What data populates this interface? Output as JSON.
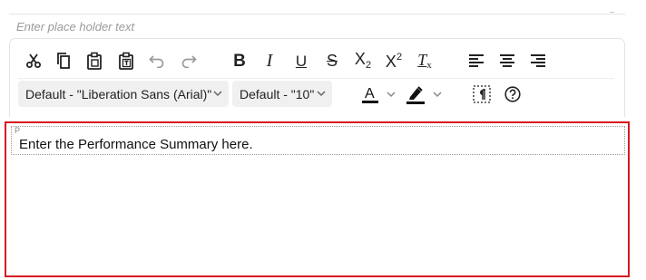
{
  "placeholder": "Enter place holder text",
  "toolbar": {
    "row1": [
      {
        "name": "cut-button",
        "icon": "scissors-icon"
      },
      {
        "name": "copy-button",
        "icon": "copy-icon"
      },
      {
        "name": "paste-button",
        "icon": "clipboard-icon"
      },
      {
        "name": "paste-text-button",
        "icon": "clipboard-text-icon"
      },
      {
        "name": "undo-button",
        "icon": "undo-icon",
        "disabled": true
      },
      {
        "name": "redo-button",
        "icon": "redo-icon",
        "disabled": true
      },
      {
        "name": "bold-button",
        "icon": "bold-icon",
        "label": "B"
      },
      {
        "name": "italic-button",
        "icon": "italic-icon",
        "label": "I"
      },
      {
        "name": "underline-button",
        "icon": "underline-icon",
        "label": "U"
      },
      {
        "name": "strikethrough-button",
        "icon": "strikethrough-icon",
        "label": "S"
      },
      {
        "name": "subscript-button",
        "icon": "subscript-icon",
        "label": "X",
        "sub": "2"
      },
      {
        "name": "superscript-button",
        "icon": "superscript-icon",
        "label": "X",
        "sup": "2"
      },
      {
        "name": "clear-format-button",
        "icon": "clear-formatting-icon",
        "label": "T",
        "sub": "x"
      },
      {
        "name": "align-left-button",
        "icon": "align-left-icon"
      },
      {
        "name": "align-center-button",
        "icon": "align-center-icon"
      },
      {
        "name": "align-right-button",
        "icon": "align-right-icon"
      }
    ],
    "font_family": "Default - \"Liberation Sans (Arial)\"",
    "font_size": "Default - \"10\"",
    "text_color_label": "A",
    "colors": {
      "accent_border": "#d71920",
      "text_color_bar": "#111111",
      "highlight_bar": "#111111"
    }
  },
  "editor": {
    "block_tag": "P",
    "content": "Enter the Performance Summary here."
  }
}
